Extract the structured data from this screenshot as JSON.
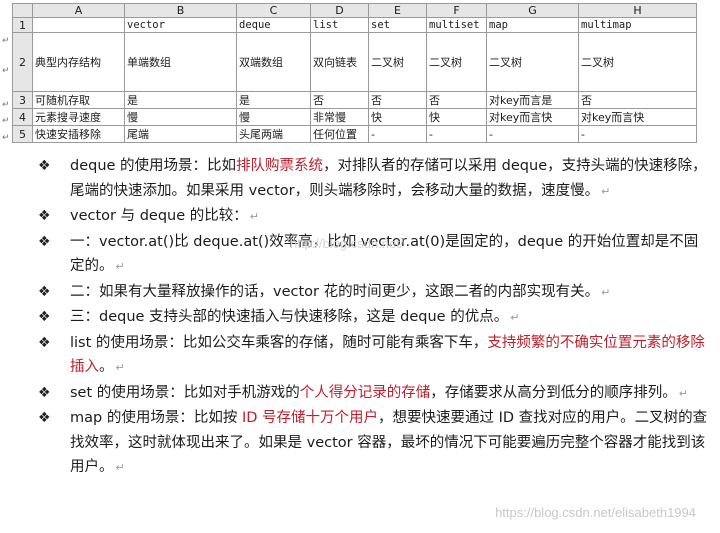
{
  "table": {
    "columns": [
      "A",
      "B",
      "C",
      "D",
      "E",
      "F",
      "G",
      "H"
    ],
    "rows": [
      {
        "num": "1",
        "cells": [
          "",
          "vector",
          "deque",
          "list",
          "set",
          "multiset",
          "map",
          "multimap"
        ]
      },
      {
        "num": "2",
        "cells": [
          "典型内存结构",
          "单端数组",
          "双端数组",
          "双向链表",
          "二叉树",
          "二叉树",
          "二叉树",
          "二叉树"
        ]
      },
      {
        "num": "3",
        "cells": [
          "可随机存取",
          "是",
          "是",
          "否",
          "否",
          "否",
          "对key而言是",
          "否"
        ]
      },
      {
        "num": "4",
        "cells": [
          "元素搜寻速度",
          "慢",
          "慢",
          "非常慢",
          "快",
          "快",
          "对key而言快",
          "对key而言快"
        ]
      },
      {
        "num": "5",
        "cells": [
          "快速安插移除",
          "尾端",
          "头尾两端",
          "任何位置",
          "-",
          "-",
          "-",
          "-"
        ]
      }
    ],
    "para_mark": "↵"
  },
  "bullets": [
    {
      "id": "deque-use",
      "parts": [
        {
          "t": "deque 的使用场景：比如"
        },
        {
          "t": "排队购票系统",
          "red": true
        },
        {
          "t": "，对排队者的存储可以采用 deque，支持头端的快速移除，尾端的快速添加。如果采用 vector，则头端移除时，会移动大量的数据，速度慢。"
        }
      ]
    },
    {
      "id": "vector-vs-deque",
      "parts": [
        {
          "t": "vector 与 deque 的比较："
        }
      ]
    },
    {
      "id": "compare-one",
      "parts": [
        {
          "t": "一：vector.at()比 deque.at()效率高，比如 vector.at(0)是固定的，deque 的开始位置却是不固定的。"
        }
      ]
    },
    {
      "id": "compare-two",
      "parts": [
        {
          "t": "二：如果有大量释放操作的话，vector 花的时间更少，这跟二者的内部实现有关。"
        }
      ]
    },
    {
      "id": "compare-three",
      "parts": [
        {
          "t": "三：deque 支持头部的快速插入与快速移除，这是 deque 的优点。"
        }
      ]
    },
    {
      "id": "list-use",
      "parts": [
        {
          "t": "list 的使用场景：比如公交车乘客的存储，随时可能有乘客下车，"
        },
        {
          "t": "支持频繁的不确实位置元素的移除插入",
          "red": true
        },
        {
          "t": "。"
        }
      ]
    },
    {
      "id": "set-use",
      "parts": [
        {
          "t": "set 的使用场景：比如对手机游戏的"
        },
        {
          "t": "个人得分记录的存储",
          "red": true
        },
        {
          "t": "，存储要求从高分到低分的顺序排列。"
        }
      ]
    },
    {
      "id": "map-use",
      "parts": [
        {
          "t": "map 的使用场景：比如按 "
        },
        {
          "t": "ID 号存储十万个用户",
          "red": true
        },
        {
          "t": "，想要快速要通过 ID 查找对应的用户。二叉树的查找效率，这时就体现出来了。如果是 vector 容器，最坏的情况下可能要遍历完整个容器才能找到该用户。"
        }
      ]
    }
  ],
  "bullet_glyph": "❖",
  "watermarks": {
    "bottom": "https://blog.csdn.net/elisabeth1994",
    "middle": "http://blog.csdn.net/"
  }
}
